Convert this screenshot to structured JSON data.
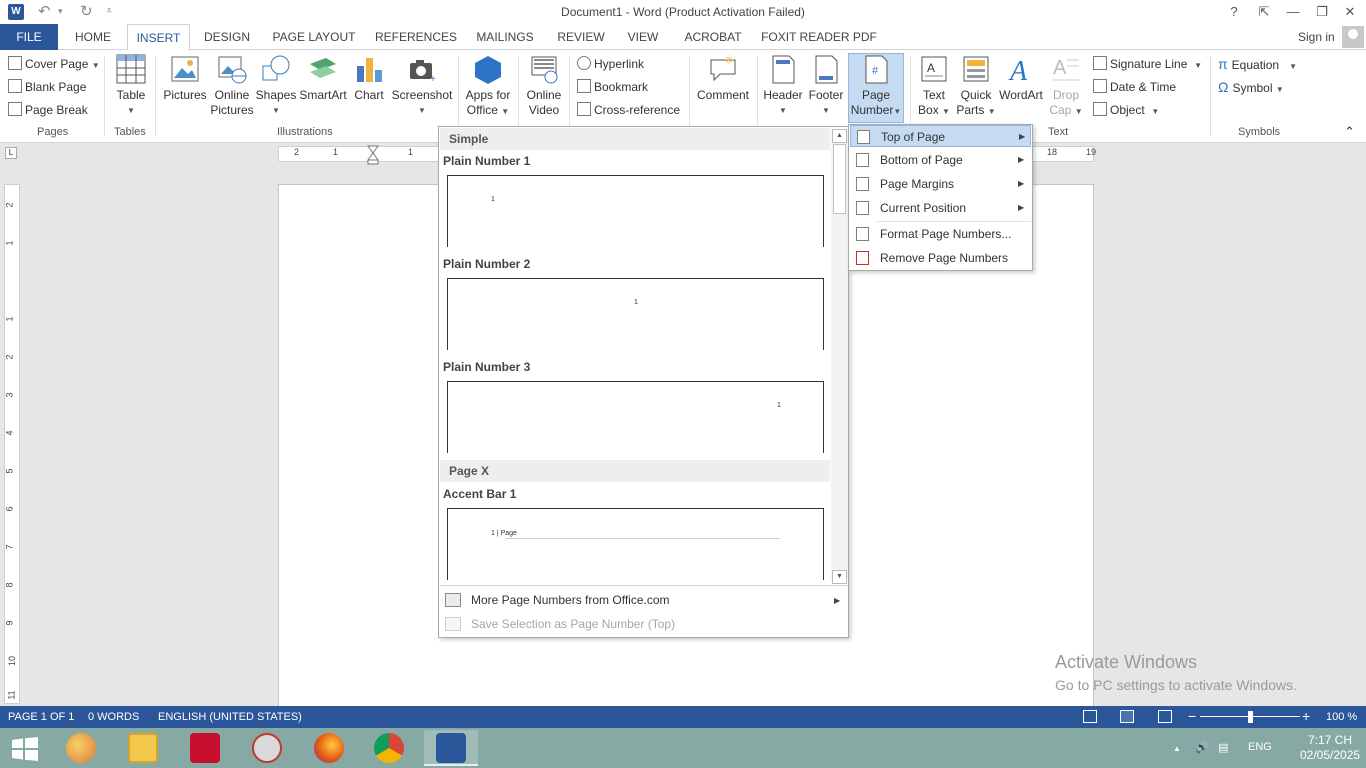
{
  "window": {
    "title": "Document1 - Word (Product Activation Failed)",
    "app_badge": "W",
    "help": "?",
    "ribbon_toggle": "⇱",
    "minimize": "—",
    "restore": "❐",
    "close": "✕"
  },
  "qat": {
    "undo": "↶",
    "undo_caret": "▾",
    "redo": "↻",
    "customize": "⩡"
  },
  "tabs": {
    "file": "FILE",
    "items": [
      "HOME",
      "INSERT",
      "DESIGN",
      "PAGE LAYOUT",
      "REFERENCES",
      "MAILINGS",
      "REVIEW",
      "VIEW",
      "ACROBAT",
      "FOXIT READER PDF"
    ],
    "active": "INSERT",
    "signin": "Sign in"
  },
  "ribbon": {
    "pages": {
      "cover_page": "Cover Page",
      "blank_page": "Blank Page",
      "page_break": "Page Break",
      "label": "Pages"
    },
    "tables": {
      "table": "Table",
      "label": "Tables"
    },
    "illustrations": {
      "pictures": "Pictures",
      "online_pictures_1": "Online",
      "online_pictures_2": "Pictures",
      "shapes": "Shapes",
      "smartart": "SmartArt",
      "chart": "Chart",
      "screenshot": "Screenshot",
      "label": "Illustrations"
    },
    "apps": {
      "apps_1": "Apps for",
      "apps_2": "Office"
    },
    "media": {
      "video_1": "Online",
      "video_2": "Video"
    },
    "links": {
      "hyperlink": "Hyperlink",
      "bookmark": "Bookmark",
      "cross_reference": "Cross-reference"
    },
    "comments": {
      "comment": "Comment"
    },
    "header_footer": {
      "header": "Header",
      "footer": "Footer",
      "page_number_1": "Page",
      "page_number_2": "Number"
    },
    "text": {
      "text_box_1": "Text",
      "text_box_2": "Box",
      "quick_parts_1": "Quick",
      "quick_parts_2": "Parts",
      "wordart": "WordArt",
      "drop_cap_1": "Drop",
      "drop_cap_2": "Cap",
      "signature_line": "Signature Line",
      "date_time": "Date & Time",
      "object": "Object",
      "label": "Text"
    },
    "symbols": {
      "equation": "Equation",
      "symbol": "Symbol",
      "label": "Symbols"
    },
    "collapse": "⌃"
  },
  "ruler": {
    "h_numbers": [
      "2",
      "1",
      "1",
      "18",
      "19"
    ],
    "v_numbers": [
      "2",
      "1",
      "1",
      "2",
      "3",
      "4",
      "5",
      "6",
      "7",
      "8",
      "9",
      "10",
      "11"
    ],
    "tab_selector": "L"
  },
  "gallery": {
    "section1": "Simple",
    "items": [
      {
        "title": "Plain Number 1",
        "num": "1"
      },
      {
        "title": "Plain Number 2",
        "num": "1"
      },
      {
        "title": "Plain Number 3",
        "num": "1"
      }
    ],
    "section2": "Page X",
    "accent": {
      "title": "Accent Bar 1",
      "num": "1 | Page"
    },
    "more": "More Page Numbers from Office.com",
    "save_selection": "Save Selection as Page Number (Top)"
  },
  "menu": {
    "items": [
      {
        "label": "Top of Page",
        "submenu": true,
        "highlighted": true
      },
      {
        "label": "Bottom of Page",
        "submenu": true
      },
      {
        "label": "Page Margins",
        "submenu": true
      },
      {
        "label": "Current Position",
        "submenu": true
      },
      {
        "label": "Format Page Numbers...",
        "submenu": false
      },
      {
        "label": "Remove Page Numbers",
        "submenu": false
      }
    ]
  },
  "watermark": {
    "line1": "Activate Windows",
    "line2": "Go to PC settings to activate Windows."
  },
  "status": {
    "page": "PAGE 1 OF 1",
    "words": "0 WORDS",
    "language": "ENGLISH (UNITED STATES)",
    "zoom": "100 %",
    "zoom_minus": "−",
    "zoom_plus": "+",
    "zoom_level": 0.5
  },
  "taskbar": {
    "apps": [
      "windows-start",
      "paint",
      "file-explorer",
      "adobe-reader",
      "snipping-tool",
      "firefox",
      "chrome",
      "word"
    ],
    "language": "ENG",
    "time": "7:17 CH",
    "date": "02/05/2025",
    "tray_up": "▲"
  },
  "colors": {
    "accent": "#2b579a",
    "highlight": "#c5dbf1",
    "taskbar": "#86a9a3"
  }
}
